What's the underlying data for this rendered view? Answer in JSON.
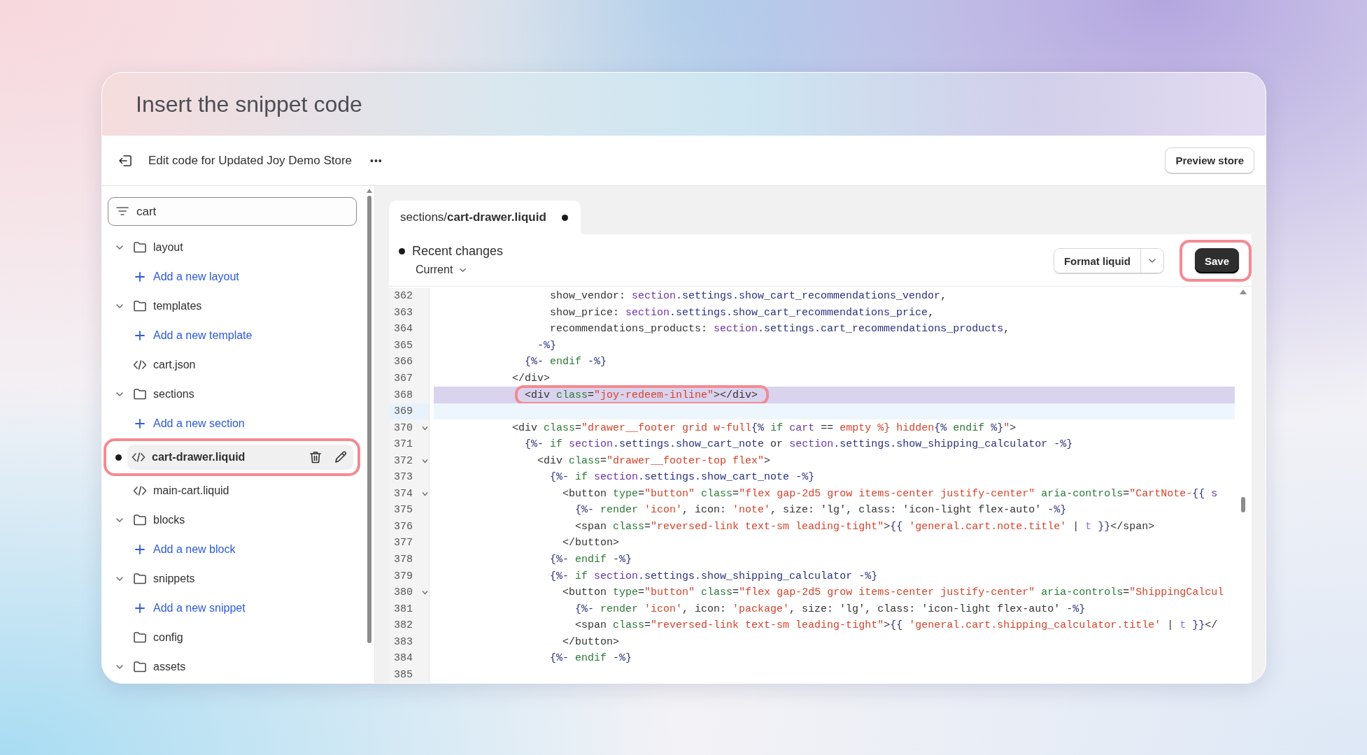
{
  "heading": "Insert the snippet code",
  "toolbar": {
    "title": "Edit code for Updated Joy Demo Store",
    "more": "•••",
    "preview_button": "Preview store"
  },
  "sidebar": {
    "search": {
      "value": "cart"
    },
    "items": [
      {
        "kind": "folder",
        "label": "layout",
        "expanded": true,
        "children": [
          {
            "kind": "add",
            "label": "Add a new layout"
          }
        ]
      },
      {
        "kind": "folder",
        "label": "templates",
        "expanded": true,
        "children": [
          {
            "kind": "add",
            "label": "Add a new template"
          },
          {
            "kind": "file",
            "label": "cart.json",
            "selected": false,
            "modified": false,
            "annotated": false
          }
        ]
      },
      {
        "kind": "folder",
        "label": "sections",
        "expanded": true,
        "children": [
          {
            "kind": "add",
            "label": "Add a new section"
          },
          {
            "kind": "file",
            "label": "cart-drawer.liquid",
            "selected": true,
            "modified": true,
            "annotated": true
          },
          {
            "kind": "file",
            "label": "main-cart.liquid",
            "selected": false,
            "modified": false,
            "annotated": false
          }
        ]
      },
      {
        "kind": "folder",
        "label": "blocks",
        "expanded": true,
        "children": [
          {
            "kind": "add",
            "label": "Add a new block"
          }
        ]
      },
      {
        "kind": "folder",
        "label": "snippets",
        "expanded": true,
        "children": [
          {
            "kind": "add",
            "label": "Add a new snippet"
          }
        ]
      },
      {
        "kind": "folder",
        "label": "config"
      },
      {
        "kind": "folder",
        "label": "assets",
        "expanded": true
      }
    ]
  },
  "editor": {
    "tabs": [
      {
        "label": "sections/**cart-drawer.liquid**",
        "selected": true,
        "modified": true
      }
    ],
    "recent_changes": "Recent changes",
    "version": "Current",
    "format_button": "Format liquid",
    "save_button": {
      "label": "Save",
      "annotated": true
    },
    "lines": [
      {
        "num": "362",
        "tokens": [
          {
            "kind": "plain",
            "text": "                  show_vendor: "
          },
          {
            "kind": "obj",
            "text": "section"
          },
          {
            "kind": "prop",
            "text": ".settings.show_cart_recommendations_vendor"
          },
          {
            "kind": "plain",
            "text": ","
          }
        ]
      },
      {
        "num": "363",
        "tokens": [
          {
            "kind": "plain",
            "text": "                  show_price: "
          },
          {
            "kind": "obj",
            "text": "section"
          },
          {
            "kind": "prop",
            "text": ".settings.show_cart_recommendations_price"
          },
          {
            "kind": "plain",
            "text": ","
          }
        ]
      },
      {
        "num": "364",
        "tokens": [
          {
            "kind": "plain",
            "text": "                  recommendations_products: "
          },
          {
            "kind": "obj",
            "text": "section"
          },
          {
            "kind": "prop",
            "text": ".settings.cart_recommendations_products"
          },
          {
            "kind": "plain",
            "text": ","
          }
        ]
      },
      {
        "num": "365",
        "tokens": [
          {
            "kind": "delim",
            "text": "                -%}"
          }
        ]
      },
      {
        "num": "366",
        "tokens": [
          {
            "kind": "delim",
            "text": "              {%- "
          },
          {
            "kind": "kw",
            "text": "endif"
          },
          {
            "kind": "delim",
            "text": " -%}"
          }
        ]
      },
      {
        "num": "367",
        "tokens": [
          {
            "kind": "plain",
            "text": "            </div>"
          }
        ]
      },
      {
        "num": "368",
        "highlighted": true,
        "annotated": true,
        "tokens": [
          {
            "kind": "plain",
            "text": "              <div "
          },
          {
            "kind": "attr",
            "text": "class"
          },
          {
            "kind": "plain",
            "text": "="
          },
          {
            "kind": "str",
            "text": "\"joy-redeem-inline\""
          },
          {
            "kind": "plain",
            "text": "></div>"
          }
        ]
      },
      {
        "num": "369",
        "current": true
      },
      {
        "num": "370",
        "fold": true,
        "tokens": [
          {
            "kind": "plain",
            "text": "            <div "
          },
          {
            "kind": "attr",
            "text": "class"
          },
          {
            "kind": "plain",
            "text": "="
          },
          {
            "kind": "str",
            "text": "\"drawer__footer grid w-full"
          },
          {
            "kind": "delim",
            "text": "{% "
          },
          {
            "kind": "kw",
            "text": "if"
          },
          {
            "kind": "obj",
            "text": " cart"
          },
          {
            "kind": "plain",
            "text": " == "
          },
          {
            "kind": "str",
            "text": "empty %} hidden"
          },
          {
            "kind": "delim",
            "text": "{% "
          },
          {
            "kind": "kw",
            "text": "endif"
          },
          {
            "kind": "delim",
            "text": " %}"
          },
          {
            "kind": "str",
            "text": "\""
          },
          {
            "kind": "plain",
            "text": ">"
          }
        ]
      },
      {
        "num": "371",
        "tokens": [
          {
            "kind": "delim",
            "text": "              {%- "
          },
          {
            "kind": "kw",
            "text": "if"
          },
          {
            "kind": "obj",
            "text": " section"
          },
          {
            "kind": "prop",
            "text": ".settings.show_cart_note"
          },
          {
            "kind": "plain",
            "text": " or "
          },
          {
            "kind": "obj",
            "text": "section"
          },
          {
            "kind": "prop",
            "text": ".settings.show_shipping_calculator"
          },
          {
            "kind": "delim",
            "text": " -%}"
          }
        ]
      },
      {
        "num": "372",
        "fold": true,
        "tokens": [
          {
            "kind": "plain",
            "text": "                <div "
          },
          {
            "kind": "attr",
            "text": "class"
          },
          {
            "kind": "plain",
            "text": "="
          },
          {
            "kind": "str",
            "text": "\"drawer__footer-top flex\""
          },
          {
            "kind": "plain",
            "text": ">"
          }
        ]
      },
      {
        "num": "373",
        "tokens": [
          {
            "kind": "delim",
            "text": "                  {%- "
          },
          {
            "kind": "kw",
            "text": "if"
          },
          {
            "kind": "obj",
            "text": " section"
          },
          {
            "kind": "prop",
            "text": ".settings.show_cart_note"
          },
          {
            "kind": "delim",
            "text": " -%}"
          }
        ]
      },
      {
        "num": "374",
        "fold": true,
        "tokens": [
          {
            "kind": "plain",
            "text": "                    <button "
          },
          {
            "kind": "attr",
            "text": "type"
          },
          {
            "kind": "plain",
            "text": "="
          },
          {
            "kind": "str",
            "text": "\"button\""
          },
          {
            "kind": "attr",
            "text": " class"
          },
          {
            "kind": "plain",
            "text": "="
          },
          {
            "kind": "str",
            "text": "\"flex gap-2d5 grow items-center justify-center\""
          },
          {
            "kind": "attr",
            "text": " aria-controls"
          },
          {
            "kind": "plain",
            "text": "="
          },
          {
            "kind": "str",
            "text": "\"CartNote-"
          },
          {
            "kind": "delim",
            "text": "{{ "
          },
          {
            "kind": "obj",
            "text": "s"
          }
        ]
      },
      {
        "num": "375",
        "tokens": [
          {
            "kind": "delim",
            "text": "                      {%- "
          },
          {
            "kind": "kw",
            "text": "render"
          },
          {
            "kind": "str",
            "text": " 'icon'"
          },
          {
            "kind": "plain",
            "text": ", icon: "
          },
          {
            "kind": "str",
            "text": "'note'"
          },
          {
            "kind": "plain",
            "text": ", size: 'lg', class: 'icon-light flex-auto' "
          },
          {
            "kind": "delim",
            "text": "-%}"
          }
        ]
      },
      {
        "num": "376",
        "tokens": [
          {
            "kind": "plain",
            "text": "                      <span "
          },
          {
            "kind": "attr",
            "text": "class"
          },
          {
            "kind": "plain",
            "text": "="
          },
          {
            "kind": "str",
            "text": "\"reversed-link text-sm leading-tight\""
          },
          {
            "kind": "plain",
            "text": ">"
          },
          {
            "kind": "delim",
            "text": "{{ "
          },
          {
            "kind": "str",
            "text": "'general.cart.note.title'"
          },
          {
            "kind": "plain",
            "text": " | "
          },
          {
            "kind": "filter",
            "text": "t"
          },
          {
            "kind": "delim",
            "text": " }}"
          },
          {
            "kind": "plain",
            "text": "</span>"
          }
        ]
      },
      {
        "num": "377",
        "tokens": [
          {
            "kind": "plain",
            "text": "                    </button>"
          }
        ]
      },
      {
        "num": "378",
        "tokens": [
          {
            "kind": "delim",
            "text": "                  {%- "
          },
          {
            "kind": "kw",
            "text": "endif"
          },
          {
            "kind": "delim",
            "text": " -%}"
          }
        ]
      },
      {
        "num": "379",
        "tokens": [
          {
            "kind": "delim",
            "text": "                  {%- "
          },
          {
            "kind": "kw",
            "text": "if"
          },
          {
            "kind": "obj",
            "text": " section"
          },
          {
            "kind": "prop",
            "text": ".settings.show_shipping_calculator"
          },
          {
            "kind": "delim",
            "text": " -%}"
          }
        ]
      },
      {
        "num": "380",
        "fold": true,
        "tokens": [
          {
            "kind": "plain",
            "text": "                    <button "
          },
          {
            "kind": "attr",
            "text": "type"
          },
          {
            "kind": "plain",
            "text": "="
          },
          {
            "kind": "str",
            "text": "\"button\""
          },
          {
            "kind": "attr",
            "text": " class"
          },
          {
            "kind": "plain",
            "text": "="
          },
          {
            "kind": "str",
            "text": "\"flex gap-2d5 grow items-center justify-center\""
          },
          {
            "kind": "attr",
            "text": " aria-controls"
          },
          {
            "kind": "plain",
            "text": "="
          },
          {
            "kind": "str",
            "text": "\"ShippingCalcul"
          }
        ]
      },
      {
        "num": "381",
        "tokens": [
          {
            "kind": "delim",
            "text": "                      {%- "
          },
          {
            "kind": "kw",
            "text": "render"
          },
          {
            "kind": "str",
            "text": " 'icon'"
          },
          {
            "kind": "plain",
            "text": ", icon: "
          },
          {
            "kind": "str",
            "text": "'package'"
          },
          {
            "kind": "plain",
            "text": ", size: 'lg', class: 'icon-light flex-auto' "
          },
          {
            "kind": "delim",
            "text": "-%}"
          }
        ]
      },
      {
        "num": "382",
        "tokens": [
          {
            "kind": "plain",
            "text": "                      <span "
          },
          {
            "kind": "attr",
            "text": "class"
          },
          {
            "kind": "plain",
            "text": "="
          },
          {
            "kind": "str",
            "text": "\"reversed-link text-sm leading-tight\""
          },
          {
            "kind": "plain",
            "text": ">"
          },
          {
            "kind": "delim",
            "text": "{{ "
          },
          {
            "kind": "str",
            "text": "'general.cart.shipping_calculator.title'"
          },
          {
            "kind": "plain",
            "text": " | "
          },
          {
            "kind": "filter",
            "text": "t"
          },
          {
            "kind": "delim",
            "text": " }}"
          },
          {
            "kind": "plain",
            "text": "</"
          }
        ]
      },
      {
        "num": "383",
        "tokens": [
          {
            "kind": "plain",
            "text": "                    </button>"
          }
        ]
      },
      {
        "num": "384",
        "tokens": [
          {
            "kind": "delim",
            "text": "                  {%- "
          },
          {
            "kind": "kw",
            "text": "endif"
          },
          {
            "kind": "delim",
            "text": " -%}"
          }
        ]
      },
      {
        "num": "385"
      }
    ]
  }
}
